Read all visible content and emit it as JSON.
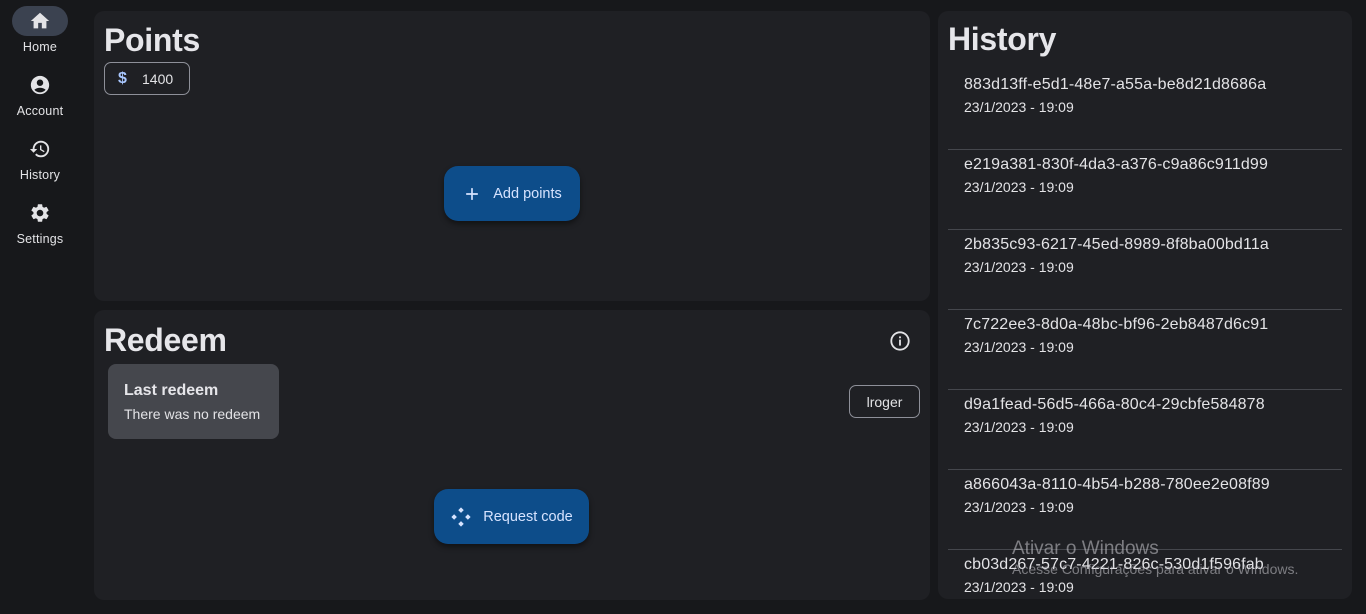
{
  "nav": {
    "items": [
      {
        "label": "Home",
        "icon": "home-icon",
        "active": true
      },
      {
        "label": "Account",
        "icon": "account-icon",
        "active": false
      },
      {
        "label": "History",
        "icon": "history-icon",
        "active": false
      },
      {
        "label": "Settings",
        "icon": "gear-icon",
        "active": false
      }
    ]
  },
  "points": {
    "title": "Points",
    "currency_symbol": "$",
    "balance": "1400",
    "add_label": "Add points"
  },
  "redeem": {
    "title": "Redeem",
    "last_title": "Last redeem",
    "last_text": "There was no redeem",
    "user_label": "lroger",
    "request_label": "Request code"
  },
  "history": {
    "title": "History",
    "items": [
      {
        "id": "883d13ff-e5d1-48e7-a55a-be8d21d8686a",
        "date": "23/1/2023 - 19:09"
      },
      {
        "id": "e219a381-830f-4da3-a376-c9a86c911d99",
        "date": "23/1/2023 - 19:09"
      },
      {
        "id": "2b835c93-6217-45ed-8989-8f8ba00bd11a",
        "date": "23/1/2023 - 19:09"
      },
      {
        "id": "7c722ee3-8d0a-48bc-bf96-2eb8487d6c91",
        "date": "23/1/2023 - 19:09"
      },
      {
        "id": "d9a1fead-56d5-466a-80c4-29cbfe584878",
        "date": "23/1/2023 - 19:09"
      },
      {
        "id": "a866043a-8110-4b54-b288-780ee2e08f89",
        "date": "23/1/2023 - 19:09"
      },
      {
        "id": "cb03d267-57c7-4221-826c-530d1f596fab",
        "date": "23/1/2023 - 19:09"
      }
    ]
  },
  "watermark": {
    "title": "Ativar o Windows",
    "subtitle": "Acesse Configurações para ativar o Windows."
  },
  "colors": {
    "background": "#17181b",
    "card": "#1f2024",
    "accent": "#0d4d8a",
    "on_accent": "#d6e3ff"
  }
}
